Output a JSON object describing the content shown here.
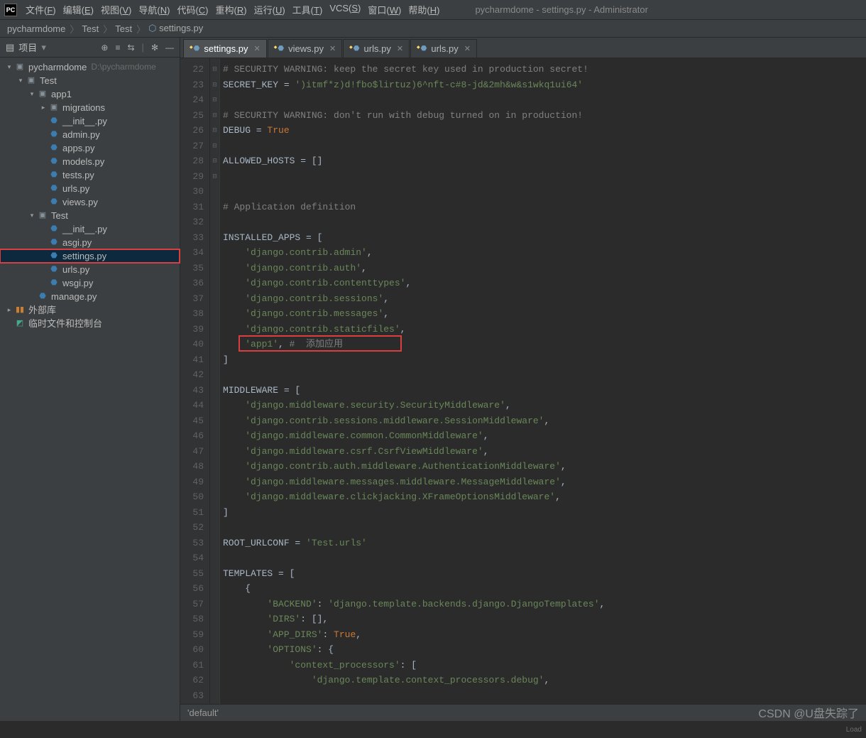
{
  "window": {
    "title": "pycharmdome - settings.py - Administrator",
    "logo": "PC"
  },
  "menus": [
    {
      "label": "文件",
      "hot": "F"
    },
    {
      "label": "编辑",
      "hot": "E"
    },
    {
      "label": "视图",
      "hot": "V"
    },
    {
      "label": "导航",
      "hot": "N"
    },
    {
      "label": "代码",
      "hot": "C"
    },
    {
      "label": "重构",
      "hot": "R"
    },
    {
      "label": "运行",
      "hot": "U"
    },
    {
      "label": "工具",
      "hot": "T"
    },
    {
      "label": "VCS",
      "hot": "S"
    },
    {
      "label": "窗口",
      "hot": "W"
    },
    {
      "label": "帮助",
      "hot": "H"
    }
  ],
  "breadcrumb": [
    "pycharmdome",
    "Test",
    "Test",
    "settings.py"
  ],
  "project_panel": {
    "title": "项目",
    "tree": [
      {
        "d": 0,
        "tw": "▾",
        "icon": "folder",
        "label": "pycharmdome",
        "sub": "D:\\pycharmdome"
      },
      {
        "d": 1,
        "tw": "▾",
        "icon": "folder",
        "label": "Test"
      },
      {
        "d": 2,
        "tw": "▾",
        "icon": "folder",
        "label": "app1"
      },
      {
        "d": 3,
        "tw": "▸",
        "icon": "folder",
        "label": "migrations"
      },
      {
        "d": 3,
        "tw": "",
        "icon": "py",
        "label": "__init__.py"
      },
      {
        "d": 3,
        "tw": "",
        "icon": "py",
        "label": "admin.py"
      },
      {
        "d": 3,
        "tw": "",
        "icon": "py",
        "label": "apps.py"
      },
      {
        "d": 3,
        "tw": "",
        "icon": "py",
        "label": "models.py"
      },
      {
        "d": 3,
        "tw": "",
        "icon": "py",
        "label": "tests.py"
      },
      {
        "d": 3,
        "tw": "",
        "icon": "py",
        "label": "urls.py"
      },
      {
        "d": 3,
        "tw": "",
        "icon": "py",
        "label": "views.py"
      },
      {
        "d": 2,
        "tw": "▾",
        "icon": "folder",
        "label": "Test"
      },
      {
        "d": 3,
        "tw": "",
        "icon": "py",
        "label": "__init__.py"
      },
      {
        "d": 3,
        "tw": "",
        "icon": "py",
        "label": "asgi.py"
      },
      {
        "d": 3,
        "tw": "",
        "icon": "py",
        "label": "settings.py",
        "selected": true,
        "hl": true
      },
      {
        "d": 3,
        "tw": "",
        "icon": "py",
        "label": "urls.py"
      },
      {
        "d": 3,
        "tw": "",
        "icon": "py",
        "label": "wsgi.py"
      },
      {
        "d": 2,
        "tw": "",
        "icon": "py",
        "label": "manage.py"
      },
      {
        "d": 0,
        "tw": "▸",
        "icon": "ext",
        "label": "外部库"
      },
      {
        "d": 0,
        "tw": "",
        "icon": "scratch",
        "label": "临时文件和控制台"
      }
    ]
  },
  "tabs": [
    {
      "label": "settings.py",
      "active": true
    },
    {
      "label": "views.py"
    },
    {
      "label": "urls.py"
    },
    {
      "label": "urls.py"
    }
  ],
  "editor": {
    "first_line": 22,
    "lines": [
      {
        "t": "# SECURITY WARNING: keep the secret key used in production secret!",
        "cls": "c-comment"
      },
      {
        "t": "SECRET_KEY = ')itmf*z)d!fbo$lirtuz)6^nft-c#8-jd&2mh&w&s1wkq1ui64'",
        "mix": [
          [
            "SECRET_KEY ",
            ""
          ],
          [
            "= ",
            "c-op"
          ],
          [
            "')itmf*z)d!fbo$lirtuz)6^nft-c#8-jd&2mh&w&s1wkq1ui64'",
            "c-str"
          ]
        ]
      },
      {
        "t": ""
      },
      {
        "t": "# SECURITY WARNING: don't run with debug turned on in production!",
        "cls": "c-comment"
      },
      {
        "t": "DEBUG = True",
        "mix": [
          [
            "DEBUG ",
            ""
          ],
          [
            "= ",
            "c-op"
          ],
          [
            "True",
            "c-bool"
          ]
        ]
      },
      {
        "t": ""
      },
      {
        "t": "ALLOWED_HOSTS = []",
        "mix": [
          [
            "ALLOWED_HOSTS ",
            ""
          ],
          [
            "= []",
            "c-op"
          ]
        ]
      },
      {
        "t": ""
      },
      {
        "t": ""
      },
      {
        "t": "# Application definition",
        "cls": "c-comment"
      },
      {
        "t": ""
      },
      {
        "t": "INSTALLED_APPS = [",
        "mix": [
          [
            "INSTALLED_APPS ",
            ""
          ],
          [
            "= [",
            "c-op"
          ]
        ],
        "fold": "⊟"
      },
      {
        "t": "    'django.contrib.admin',",
        "mix": [
          [
            "    ",
            ""
          ],
          [
            "'django.contrib.admin'",
            "c-str"
          ],
          [
            ",",
            ""
          ]
        ]
      },
      {
        "t": "    'django.contrib.auth',",
        "mix": [
          [
            "    ",
            ""
          ],
          [
            "'django.contrib.auth'",
            "c-str"
          ],
          [
            ",",
            ""
          ]
        ]
      },
      {
        "t": "    'django.contrib.contenttypes',",
        "mix": [
          [
            "    ",
            ""
          ],
          [
            "'django.contrib.contenttypes'",
            "c-str"
          ],
          [
            ",",
            ""
          ]
        ]
      },
      {
        "t": "    'django.contrib.sessions',",
        "mix": [
          [
            "    ",
            ""
          ],
          [
            "'django.contrib.sessions'",
            "c-str"
          ],
          [
            ",",
            ""
          ]
        ]
      },
      {
        "t": "    'django.contrib.messages',",
        "mix": [
          [
            "    ",
            ""
          ],
          [
            "'django.contrib.messages'",
            "c-str"
          ],
          [
            ",",
            ""
          ]
        ]
      },
      {
        "t": "    'django.contrib.staticfiles',",
        "mix": [
          [
            "    ",
            ""
          ],
          [
            "'django.contrib.staticfiles'",
            "c-str"
          ],
          [
            ",",
            ""
          ]
        ]
      },
      {
        "t": "    'app1', #  添加应用",
        "mix": [
          [
            "    ",
            ""
          ],
          [
            "'app1'",
            "c-str"
          ],
          [
            ", ",
            ""
          ],
          [
            "#  添加应用",
            "c-comment"
          ]
        ],
        "hl": true
      },
      {
        "t": "]",
        "fold": "⊟"
      },
      {
        "t": ""
      },
      {
        "t": "MIDDLEWARE = [",
        "mix": [
          [
            "MIDDLEWARE ",
            ""
          ],
          [
            "= [",
            "c-op"
          ]
        ],
        "fold": "⊟"
      },
      {
        "t": "    'django.middleware.security.SecurityMiddleware',",
        "mix": [
          [
            "    ",
            ""
          ],
          [
            "'django.middleware.security.SecurityMiddleware'",
            "c-str"
          ],
          [
            ",",
            ""
          ]
        ]
      },
      {
        "t": "    'django.contrib.sessions.middleware.SessionMiddleware',",
        "mix": [
          [
            "    ",
            ""
          ],
          [
            "'django.contrib.sessions.middleware.SessionMiddleware'",
            "c-str"
          ],
          [
            ",",
            ""
          ]
        ]
      },
      {
        "t": "    'django.middleware.common.CommonMiddleware',",
        "mix": [
          [
            "    ",
            ""
          ],
          [
            "'django.middleware.common.CommonMiddleware'",
            "c-str"
          ],
          [
            ",",
            ""
          ]
        ]
      },
      {
        "t": "    'django.middleware.csrf.CsrfViewMiddleware',",
        "mix": [
          [
            "    ",
            ""
          ],
          [
            "'django.middleware.csrf.CsrfViewMiddleware'",
            "c-str"
          ],
          [
            ",",
            ""
          ]
        ]
      },
      {
        "t": "    'django.contrib.auth.middleware.AuthenticationMiddleware',",
        "mix": [
          [
            "    ",
            ""
          ],
          [
            "'django.contrib.auth.middleware.AuthenticationMiddleware'",
            "c-str"
          ],
          [
            ",",
            ""
          ]
        ]
      },
      {
        "t": "    'django.middleware.messages.middleware.MessageMiddleware',",
        "mix": [
          [
            "    ",
            ""
          ],
          [
            "'django.middleware.messages.middleware.MessageMiddleware'",
            "c-str"
          ],
          [
            ",",
            ""
          ]
        ]
      },
      {
        "t": "    'django.middleware.clickjacking.XFrameOptionsMiddleware',",
        "mix": [
          [
            "    ",
            ""
          ],
          [
            "'django.middleware.clickjacking.XFrameOptionsMiddleware'",
            "c-str"
          ],
          [
            ",",
            ""
          ]
        ]
      },
      {
        "t": "]",
        "fold": "⊟"
      },
      {
        "t": ""
      },
      {
        "t": "ROOT_URLCONF = 'Test.urls'",
        "mix": [
          [
            "ROOT_URLCONF ",
            ""
          ],
          [
            "= ",
            "c-op"
          ],
          [
            "'Test.urls'",
            "c-str"
          ]
        ]
      },
      {
        "t": ""
      },
      {
        "t": "TEMPLATES = [",
        "mix": [
          [
            "TEMPLATES ",
            ""
          ],
          [
            "= [",
            "c-op"
          ]
        ],
        "fold": "⊟"
      },
      {
        "t": "    {",
        "fold": "⊟"
      },
      {
        "t": "        'BACKEND': 'django.template.backends.django.DjangoTemplates',",
        "mix": [
          [
            "        ",
            ""
          ],
          [
            "'BACKEND'",
            "c-str"
          ],
          [
            ": ",
            ""
          ],
          [
            "'django.template.backends.django.DjangoTemplates'",
            "c-str"
          ],
          [
            ",",
            ""
          ]
        ]
      },
      {
        "t": "        'DIRS': [],",
        "mix": [
          [
            "        ",
            ""
          ],
          [
            "'DIRS'",
            "c-str"
          ],
          [
            ": [],",
            ""
          ]
        ]
      },
      {
        "t": "        'APP_DIRS': True,",
        "mix": [
          [
            "        ",
            ""
          ],
          [
            "'APP_DIRS'",
            "c-str"
          ],
          [
            ": ",
            ""
          ],
          [
            "True",
            "c-bool"
          ],
          [
            ",",
            ""
          ]
        ]
      },
      {
        "t": "        'OPTIONS': {",
        "mix": [
          [
            "        ",
            ""
          ],
          [
            "'OPTIONS'",
            "c-str"
          ],
          [
            ": {",
            ""
          ]
        ],
        "fold": "⊟"
      },
      {
        "t": "            'context_processors': [",
        "mix": [
          [
            "            ",
            ""
          ],
          [
            "'context_processors'",
            "c-str"
          ],
          [
            ": [",
            ""
          ]
        ],
        "fold": "⊟"
      },
      {
        "t": "                'django.template.context_processors.debug',",
        "mix": [
          [
            "                ",
            ""
          ],
          [
            "'django.template.context_processors.debug'",
            "c-str"
          ],
          [
            ",",
            ""
          ]
        ]
      },
      {
        "t": ""
      }
    ],
    "status_crumb": "'default'"
  },
  "watermark": "CSDN @U盘失踪了",
  "load": "Load"
}
